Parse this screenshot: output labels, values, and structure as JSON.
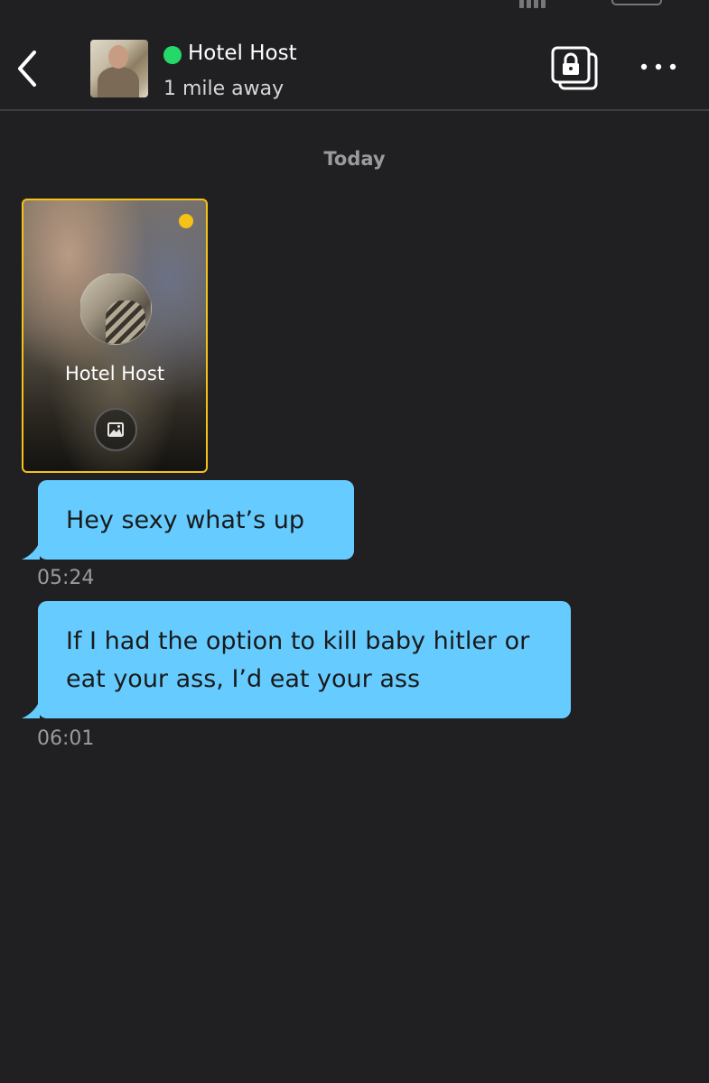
{
  "header": {
    "contact_name": "Hotel Host",
    "distance": "1 mile away",
    "online_color": "#25d86a",
    "icons": {
      "back": "chevron-left-icon",
      "album": "locked-album-icon",
      "more": "more-horizontal-icon"
    }
  },
  "chat": {
    "date_label": "Today",
    "profile_card": {
      "name": "Hotel Host",
      "status_color": "#f5c218",
      "photo_icon": "image-icon"
    },
    "messages": [
      {
        "text": "Hey sexy what’s up",
        "time": "05:24"
      },
      {
        "text": "If I had the option to kill baby hitler or eat your ass, I’d eat your ass",
        "time": "06:01"
      }
    ],
    "bubble_color": "#66ccff"
  }
}
